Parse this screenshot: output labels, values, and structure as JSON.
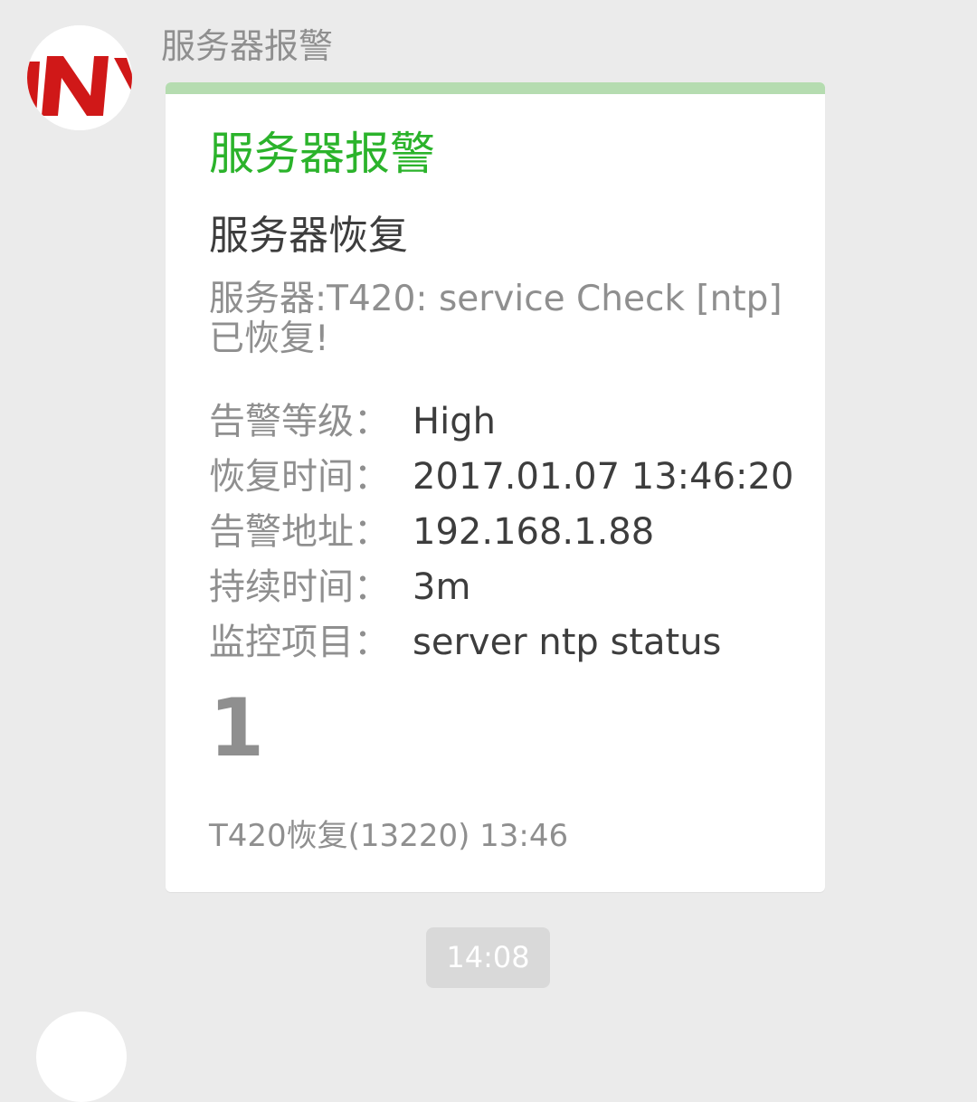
{
  "message": {
    "sender_name": "服务器报警",
    "avatar_icon": "brand-logo-icon",
    "card": {
      "accent_color": "#2bb32b",
      "top_bar_color": "#b5dcb0",
      "title": "服务器报警",
      "subtitle": "服务器恢复",
      "description": "服务器:T420: service Check [ntp]已恢复!",
      "fields": [
        {
          "label": "告警等级：",
          "value": "High"
        },
        {
          "label": "恢复时间：",
          "value": "2017.01.07 13:46:20"
        },
        {
          "label": "告警地址：",
          "value": "192.168.1.88"
        },
        {
          "label": "持续时间：",
          "value": "3m"
        },
        {
          "label": "监控项目：",
          "value": "server ntp status"
        }
      ],
      "big_number": "1",
      "footer": "T420恢复(13220) 13:46"
    }
  },
  "timestamp_divider": "14:08"
}
